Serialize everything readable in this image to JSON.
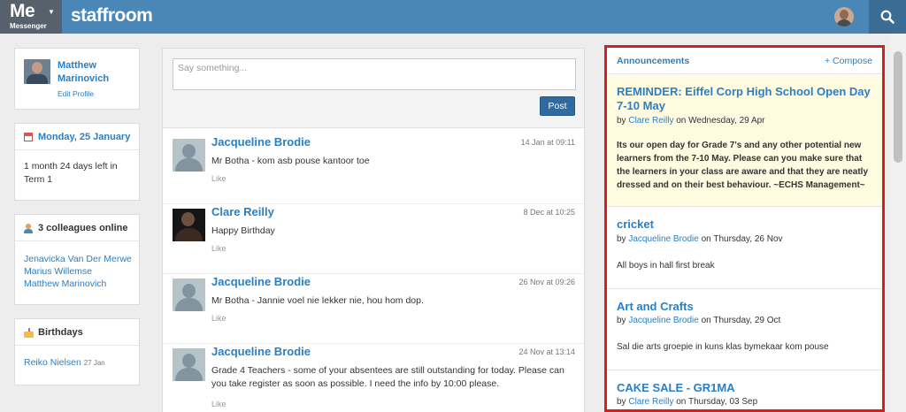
{
  "topbar": {
    "logo_main": "Me",
    "logo_sub": "Messenger",
    "app_name": "staffroom"
  },
  "profile": {
    "name": "Matthew Marinovich",
    "edit_label": "Edit Profile"
  },
  "date_widget": {
    "title": "Monday, 25 January",
    "text": "1 month 24 days left in Term 1"
  },
  "online_widget": {
    "title": "3 colleagues online",
    "people": [
      "Jenavicka Van Der Merwe",
      "Marius Willemse",
      "Matthew Marinovich"
    ]
  },
  "birthdays_widget": {
    "title": "Birthdays",
    "name": "Reiko Nielsen",
    "date": "27 Jan"
  },
  "composer": {
    "placeholder": "Say something...",
    "post_label": "Post"
  },
  "feed": [
    {
      "name": "Jacqueline Brodie",
      "time": "14 Jan at 09:11",
      "text": "Mr Botha - kom asb pouse kantoor toe",
      "like": "Like"
    },
    {
      "name": "Clare Reilly",
      "time": "8 Dec at 10:25",
      "text": "Happy Birthday",
      "like": "Like"
    },
    {
      "name": "Jacqueline Brodie",
      "time": "26 Nov at 09:26",
      "text": "Mr Botha - Jannie voel nie lekker nie, hou hom dop.",
      "like": "Like"
    },
    {
      "name": "Jacqueline Brodie",
      "time": "24 Nov at 13:14",
      "text": "Grade 4 Teachers - some of your absentees are still outstanding for today. Please can you take register as soon as possible. I need the info by 10:00 please.",
      "like": "Like"
    }
  ],
  "announcements": {
    "title": "Announcements",
    "compose_label": "+ Compose",
    "items": [
      {
        "title": "REMINDER: Eiffel Corp High School Open Day 7-10 May",
        "by": "by",
        "author": "Clare Reilly",
        "on": "on Wednesday, 29 Apr",
        "body": "Its our open day for Grade 7's and any other potential new learners from the 7-10 May.  Please can you make sure that the learners in your class are aware and that they are neatly dressed and on their best behaviour.  ~ECHS Management~"
      },
      {
        "title": "cricket",
        "by": "by",
        "author": "Jacqueline Brodie",
        "on": "on Thursday, 26 Nov",
        "body": "All boys in hall first break"
      },
      {
        "title": "Art and Crafts",
        "by": "by",
        "author": "Jacqueline Brodie",
        "on": "on Thursday, 29 Oct",
        "body": "Sal die arts groepie in kuns klas bymekaar kom pouse"
      },
      {
        "title": "CAKE SALE - GR1MA",
        "by": "by",
        "author": "Clare Reilly",
        "on": "on Thursday, 03 Sep",
        "body": ""
      }
    ]
  },
  "colors": {
    "topbar": "#4a86b6",
    "link": "#2a7fc4",
    "highlight_border": "#d21f1f",
    "highlight_bg": "#fffbe1"
  }
}
